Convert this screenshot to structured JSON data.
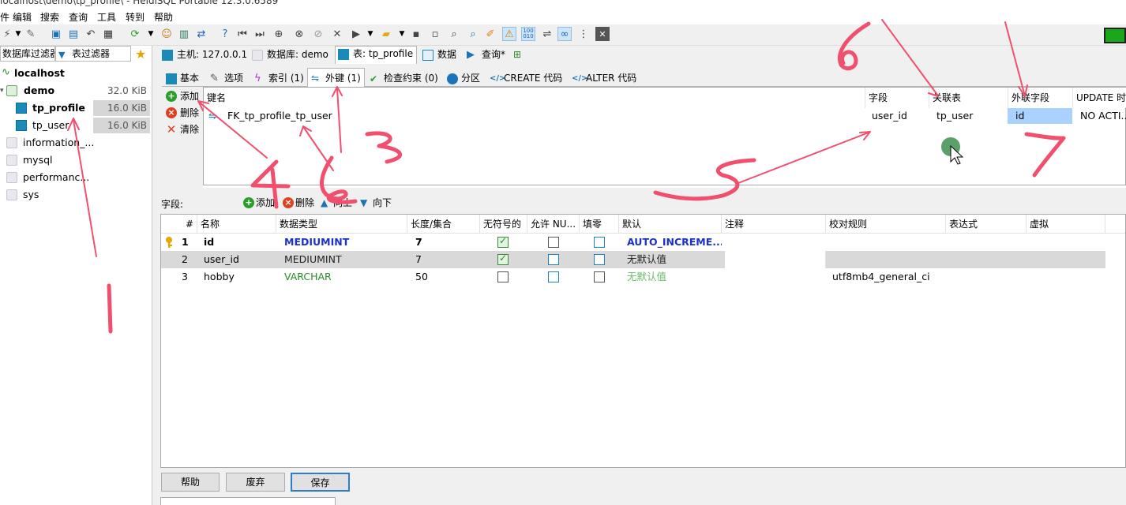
{
  "window": {
    "title": "localhost\\demo\\tp_profile\\ - HeidiSQL Portable 12.3.0.6589"
  },
  "menu": {
    "items": [
      "件",
      "编辑",
      "搜索",
      "查询",
      "工具",
      "转到",
      "帮助"
    ]
  },
  "colors": {
    "accent": "#2c7cd1",
    "selection": "#a9d2ff",
    "status_green": "#1aa81a",
    "annotation_red": "#f0506e"
  },
  "left": {
    "db_filter_placeholder": "数据库过滤器",
    "table_filter_placeholder": "表过滤器",
    "tree": [
      {
        "label": "localhost",
        "size": "",
        "level": 0
      },
      {
        "label": "demo",
        "size": "32.0 KiB",
        "level": 1
      },
      {
        "label": "tp_profile",
        "size": "16.0 KiB",
        "level": 2
      },
      {
        "label": "tp_user",
        "size": "16.0 KiB",
        "level": 2
      },
      {
        "label": "information_...",
        "size": "",
        "level": 1
      },
      {
        "label": "mysql",
        "size": "",
        "level": 1
      },
      {
        "label": "performanc...",
        "size": "",
        "level": 1
      },
      {
        "label": "sys",
        "size": "",
        "level": 1
      }
    ]
  },
  "tabs1": [
    "主机: 127.0.0.1",
    "数据库: demo",
    "表: tp_profile",
    "数据",
    "查询*"
  ],
  "tabs2": [
    "基本",
    "选项",
    "索引 (1)",
    "外键 (1)",
    "检查约束 (0)",
    "分区",
    "CREATE 代码",
    "ALTER 代码"
  ],
  "fk": {
    "side_buttons": [
      "添加",
      "删除",
      "清除"
    ],
    "headers": [
      "键名",
      "字段",
      "关联表",
      "外联字段",
      "UPDATE 时"
    ],
    "row": {
      "name": "FK_tp_profile_tp_user",
      "field": "user_id",
      "ref_table": "tp_user",
      "ref_field": "id",
      "update": "NO ACTI..."
    }
  },
  "fields_bar": {
    "label": "字段:",
    "add": "添加",
    "delete": "删除",
    "up": "向上",
    "down": "向下"
  },
  "columns": {
    "headers": [
      "#",
      "名称",
      "数据类型",
      "长度/集合",
      "无符号的",
      "允许 NU...",
      "填零",
      "默认",
      "注释",
      "校对规则",
      "表达式",
      "虚拟"
    ],
    "rows": [
      {
        "num": "1",
        "name": "id",
        "type": "MEDIUMINT",
        "length": "7",
        "unsigned": true,
        "nullable": false,
        "zerofill": false,
        "default": "AUTO_INCREME...",
        "collation": ""
      },
      {
        "num": "2",
        "name": "user_id",
        "type": "MEDIUMINT",
        "length": "7",
        "unsigned": true,
        "nullable": false,
        "zerofill": false,
        "default": "无默认值",
        "collation": ""
      },
      {
        "num": "3",
        "name": "hobby",
        "type": "VARCHAR",
        "length": "50",
        "unsigned": false,
        "nullable": false,
        "zerofill": false,
        "default": "无默认值",
        "collation": "utf8mb4_general_ci"
      }
    ]
  },
  "buttons": {
    "help": "帮助",
    "discard": "废弃",
    "save": "保存"
  }
}
